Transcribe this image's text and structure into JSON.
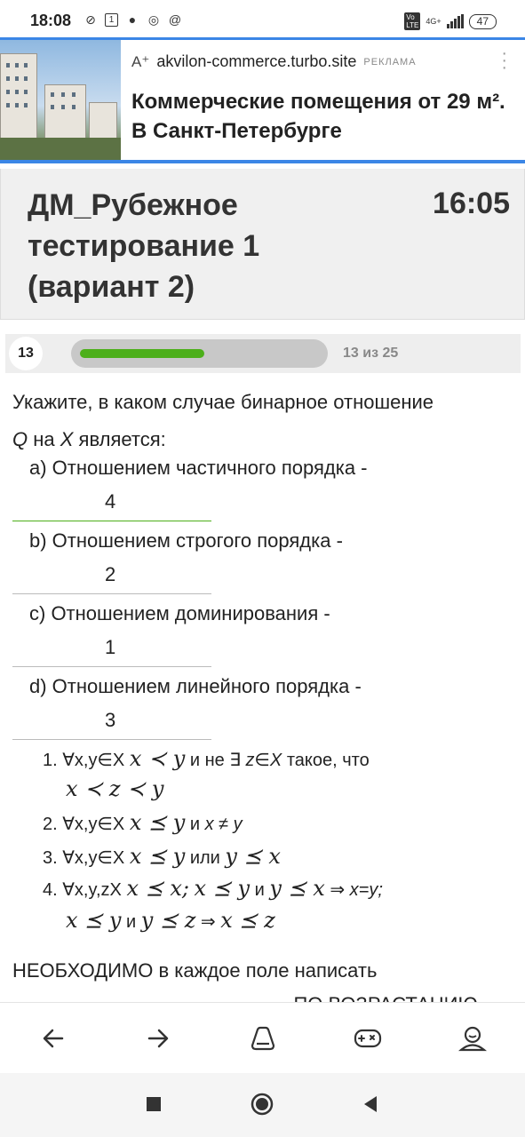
{
  "status_bar": {
    "time": "18:08",
    "battery": "47",
    "network": "4G+"
  },
  "ad": {
    "domain": "akvilon-commerce.turbo.site",
    "label": "РЕКЛАМА",
    "title": "Коммерческие помещения от 29 м². В Санкт-Петербурге"
  },
  "test": {
    "title": "ДМ_Рубежное тестирование 1 (вариант 2)",
    "timer": "16:05"
  },
  "progress": {
    "current": "13",
    "count_text": "13 из 25",
    "fraction": 0.52
  },
  "question": {
    "line1": "Укажите, в каком случае бинарное отношение",
    "var_q": "Q",
    "on": " на ",
    "var_x": "X",
    "suffix": " является:",
    "options": [
      {
        "label": "a) Отношением частичного порядка -",
        "answer": "4"
      },
      {
        "label": "b) Отношением строгого порядка -",
        "answer": "2"
      },
      {
        "label": "c) Отношением доминирования -",
        "answer": "1"
      },
      {
        "label": "d) Отношением линейного порядка -",
        "answer": "3"
      }
    ]
  },
  "definitions": {
    "d1_prefix": "1. ∀x,y∈X",
    "d1_expr": "x ≺ y",
    "d1_mid": "и не ∃",
    "d1_zx": "z∈X",
    "d1_tail": "такое,  что",
    "d1_expr2": "x ≺ z ≺ y",
    "d2_prefix": "2. ∀x,y∈X",
    "d2_expr": "x ⪯ y",
    "d2_mid": "и",
    "d2_tail": "x ≠ y",
    "d3_prefix": "3. ∀x,y∈X",
    "d3_expr": "x ⪯ y",
    "d3_mid": "или",
    "d3_expr2": "y ⪯ x",
    "d4_prefix": "4. ∀x,y,zX",
    "d4_expr": "x ⪯ x;",
    "d4_expr2": "x ⪯ y",
    "d4_mid": "и",
    "d4_expr3": "y ⪯ x",
    "d4_arrow": "⇒",
    "d4_tail": "x=y;",
    "d5_expr": "x ⪯ y",
    "d5_mid": "и",
    "d5_expr2": "y ⪯ z",
    "d5_arrow": "⇒",
    "d5_expr3": "x ⪯ z"
  },
  "note": {
    "line1": "НЕОБХОДИМО в каждое поле написать",
    "line2": "... ПО ВОЗРАСТАНИЮ"
  },
  "colors": {
    "accent": "#3b86e6",
    "progress": "#4caf1a"
  },
  "toolbar": {
    "icons": [
      "back-icon",
      "forward-icon",
      "tabs-icon",
      "games-icon",
      "profile-icon"
    ]
  }
}
